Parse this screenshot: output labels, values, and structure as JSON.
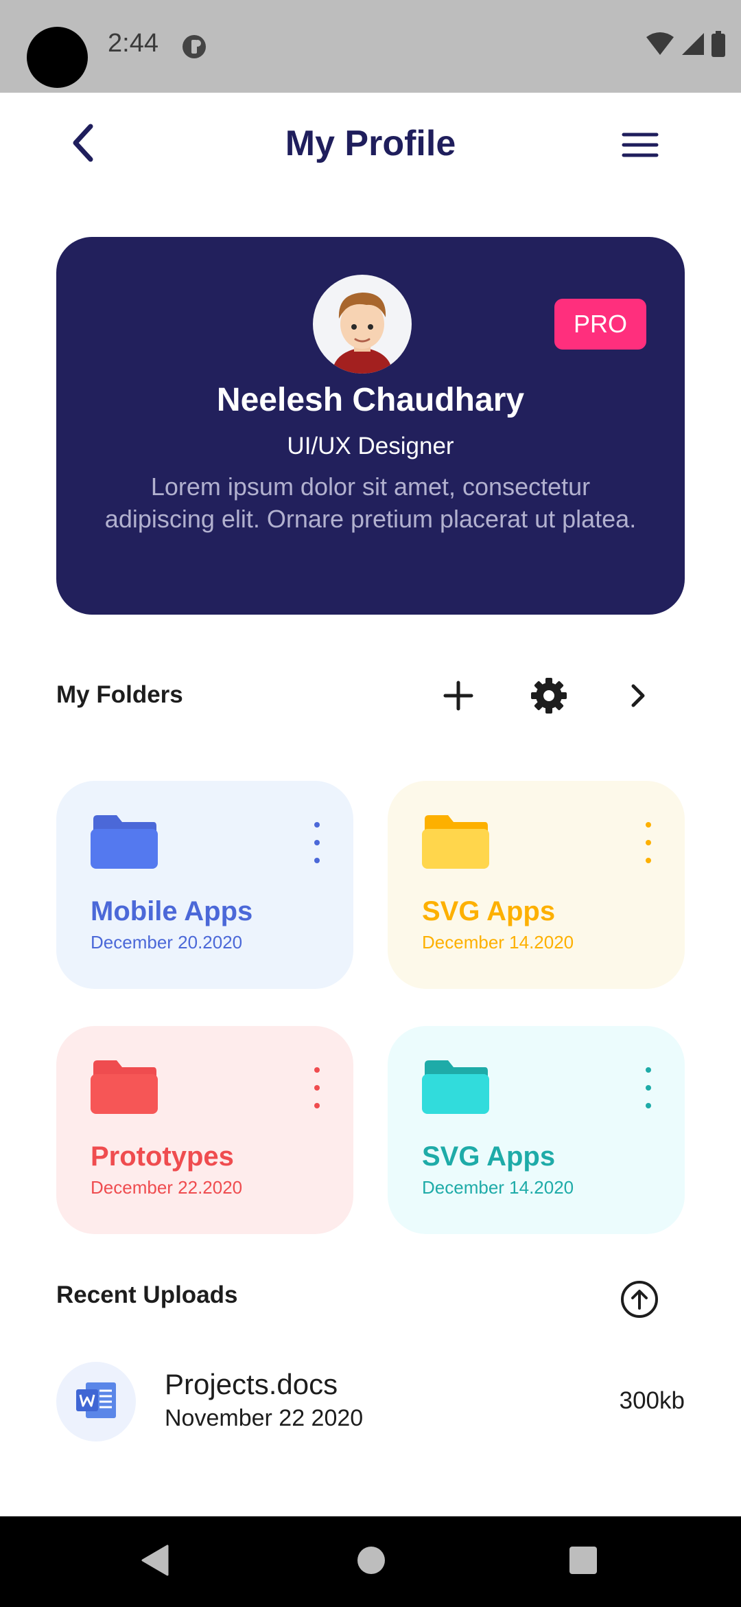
{
  "status_bar": {
    "time": "2:44"
  },
  "header": {
    "title": "My Profile"
  },
  "profile": {
    "badge": "PRO",
    "name": "Neelesh Chaudhary",
    "role": "UI/UX Designer",
    "bio": "Lorem ipsum dolor sit amet, consectetur adipiscing elit. Ornare pretium placerat ut platea."
  },
  "folders_section": {
    "title": "My Folders",
    "folders": [
      {
        "name": "Mobile Apps",
        "date": "December 20.2020",
        "color": "#4b68d8",
        "icon_color": "#5479ef",
        "bg": "#edf4fd"
      },
      {
        "name": "SVG Apps",
        "date": "December 14.2020",
        "color": "#fdb000",
        "icon_color": "#ffd64c",
        "bg": "#fdf9ea"
      },
      {
        "name": "Prototypes",
        "date": "December 22.2020",
        "color": "#ef4c4f",
        "icon_color": "#f65656",
        "bg": "#feecec"
      },
      {
        "name": "SVG Apps",
        "date": "December 14.2020",
        "color": "#1eaba8",
        "icon_color": "#31dcdc",
        "bg": "#ecfcfd"
      }
    ]
  },
  "uploads_section": {
    "title": "Recent Uploads",
    "items": [
      {
        "name": "Projects.docs",
        "date": "November 22 2020",
        "size": "300kb"
      }
    ]
  },
  "colors": {
    "primary": "#22205c",
    "accent": "#ff2f7d"
  }
}
